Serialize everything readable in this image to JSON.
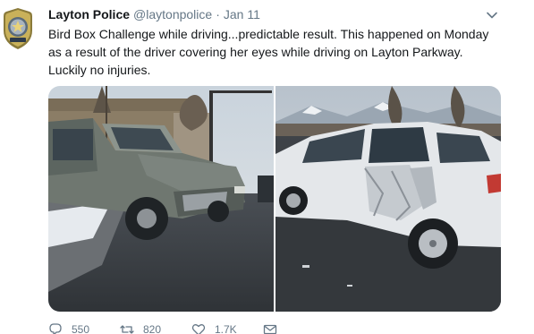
{
  "tweet": {
    "author_name": "Layton Police",
    "handle": "@laytonpolice",
    "separator": "·",
    "date": "Jan 11",
    "text_lines": [
      "Bird Box Challenge while driving...predictable result.  This happened on Monday",
      "as a result of the driver covering her eyes while driving on Layton Parkway.",
      "Luckily no injuries."
    ]
  },
  "icons": {
    "avatar": "police-badge-avatar",
    "caret": "chevron-down-icon",
    "reply": "reply-icon",
    "retweet": "retweet-icon",
    "like": "heart-icon",
    "dm": "envelope-icon"
  },
  "media": {
    "photos": [
      "crashed-gray-pickup-truck-photo",
      "crashed-white-suv-photo"
    ]
  },
  "actions": {
    "replies": "550",
    "retweets": "820",
    "likes": "1.7K"
  },
  "colors": {
    "text": "#14171a",
    "secondary": "#657786",
    "badge_gold": "#b8a14a"
  }
}
